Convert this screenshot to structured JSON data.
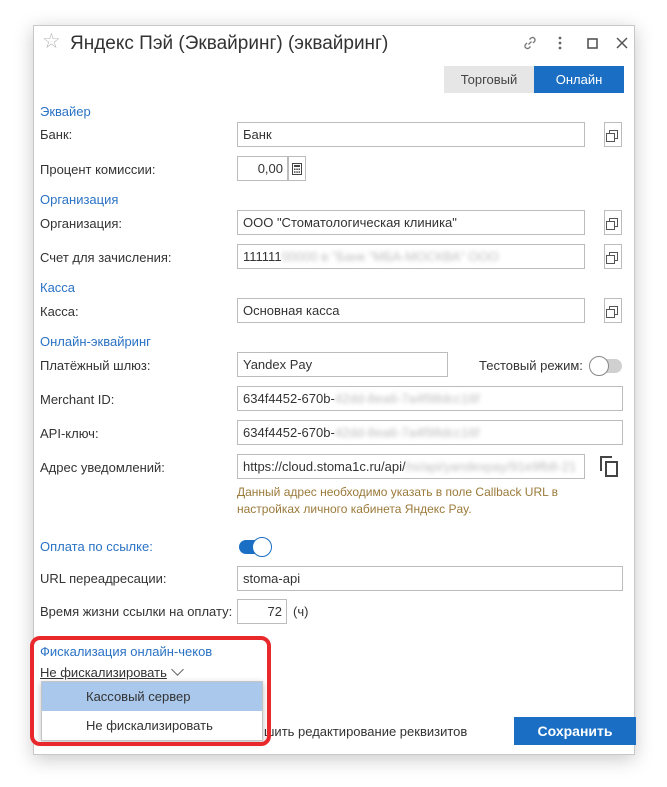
{
  "window": {
    "title": "Яндекс Пэй (Эквайринг) (эквайринг)",
    "star_icon": "star-icon",
    "link_icon": "link-icon",
    "more_icon": "more-vertical-icon",
    "maximize_icon": "maximize-icon",
    "close_icon": "close-icon"
  },
  "tabs": [
    {
      "label": "Торговый",
      "active": false
    },
    {
      "label": "Онлайн",
      "active": true
    }
  ],
  "sections": {
    "acquirer": "Эквайер",
    "organization": "Организация",
    "cashbox": "Касса",
    "online": "Онлайн-эквайринг",
    "fiscal": "Фискализация онлайн-чеков"
  },
  "fields": {
    "bank": {
      "label": "Банк:",
      "value": "Банк"
    },
    "commission": {
      "label": "Процент комиссии:",
      "value": "0,00"
    },
    "organization": {
      "label": "Организация:",
      "value": "ООО \"Стоматологическая клиника\""
    },
    "account": {
      "label": "Счет для зачисления:",
      "value": "111111",
      "blurred": "00000 в \"Банк \"МБА-МОСКВА\" ООО"
    },
    "cashbox": {
      "label": "Касса:",
      "value": "Основная касса"
    },
    "gateway": {
      "label": "Платёжный шлюз:",
      "value": "Yandex Pay"
    },
    "test_mode": {
      "label": "Тестовый режим:",
      "on": false
    },
    "merchant_id": {
      "label": "Merchant ID:",
      "value": "634f4452-670b-",
      "blurred": "42dd-8ea6-7a4f98dcc16f"
    },
    "api_key": {
      "label": "API-ключ:",
      "value": "634f4452-670b-",
      "blurred": "42dd-8ea6-7a4f98dcc16f"
    },
    "callback": {
      "label": "Адрес уведомлений:",
      "value": "https://cloud.stoma1c.ru/api/",
      "blurred": "hs/api/yandexpay/91e9fb8-21"
    },
    "callback_hint": "Данный адрес необходимо указать в поле Callback URL в настройках личного кабинета Яндекс Pay.",
    "pay_by_link": {
      "label": "Оплата по ссылке:",
      "on": true
    },
    "redirect_url": {
      "label": "URL переадресации:",
      "value": "stoma-api"
    },
    "link_lifetime": {
      "label": "Время жизни ссылки на оплату:",
      "value": "72",
      "unit": "(ч)"
    }
  },
  "fiscal": {
    "selected": "Не фискализировать",
    "options": [
      "Кассовый сервер",
      "Не фискализировать"
    ],
    "highlighted_option": "Кассовый сервер"
  },
  "footer": {
    "partial_text": "шить редактирование реквизитов",
    "save_label": "Сохранить"
  },
  "colors": {
    "accent": "#1a6fc4",
    "section": "#2a72c4",
    "hint": "#9b7a3a",
    "annotation": "#e8282b"
  }
}
